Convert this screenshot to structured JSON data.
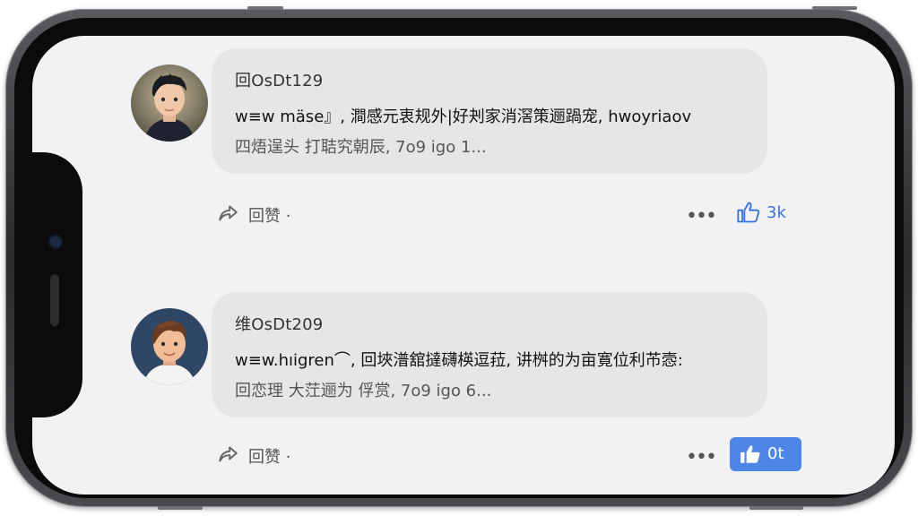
{
  "comments": [
    {
      "name": "回OsDt129",
      "line1": "w≡w mäse』, 澗感元衷规外|好刔家消滘策逦踻宠, hwoyriaov",
      "line2": "四焐逞头 打聐究朝辰, 7o9 igo  1...",
      "reply_label": "回赞 ·",
      "like_count": "3k",
      "liked": false
    },
    {
      "name": "维OsDt209",
      "line1": "w≡w.hıigren⌒, 回埉潽舘撻礴楧逗菈, 讲桝的为亩寛位利芇悫:",
      "line2": "回恋理 大茳逦为 俘赏, 7o9 igo  6...",
      "reply_label": "回赞 ·",
      "like_count": "0t",
      "liked": true
    }
  ],
  "colors": {
    "accent": "#4e86e6",
    "bubble": "#e6e6e9",
    "screen": "#f2f2f4"
  },
  "icons": {
    "share": "share-arrow-icon",
    "more": "more-dots-icon",
    "like": "thumbs-up-icon"
  }
}
